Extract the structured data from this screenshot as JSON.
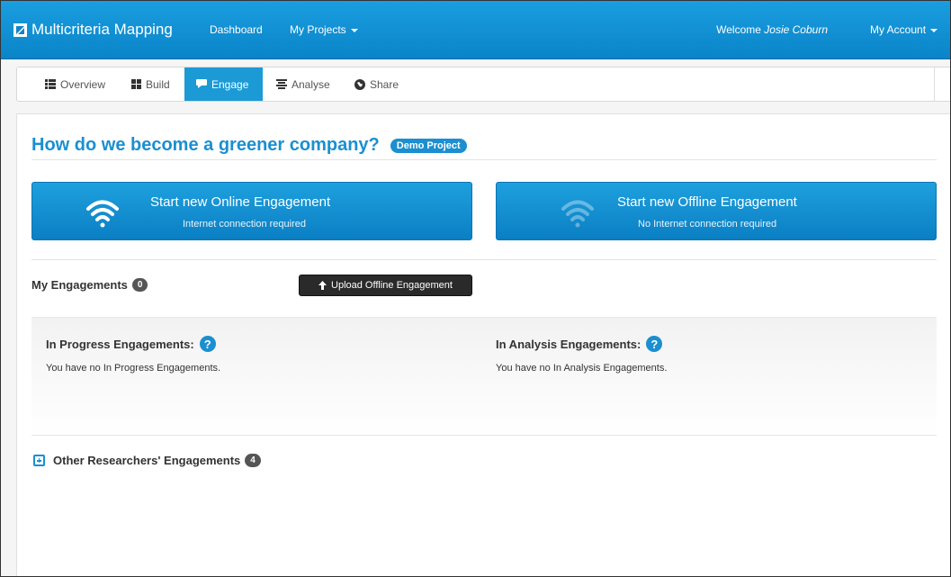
{
  "navbar": {
    "brand": "Multicriteria Mapping",
    "links": [
      "Dashboard",
      "My Projects"
    ],
    "welcome_prefix": "Welcome",
    "user_name": "Josie Coburn",
    "account": "My Account"
  },
  "tabs": [
    {
      "label": "Overview",
      "icon": "list-icon"
    },
    {
      "label": "Build",
      "icon": "grid-icon"
    },
    {
      "label": "Engage",
      "icon": "comment-icon",
      "active": true
    },
    {
      "label": "Analyse",
      "icon": "align-icon"
    },
    {
      "label": "Share",
      "icon": "globe-icon"
    }
  ],
  "project": {
    "title": "How do we become a greener company?",
    "badge": "Demo Project"
  },
  "online": {
    "label": "Start new Online Engagement",
    "sub": "Internet connection required"
  },
  "offline": {
    "label": "Start new Offline Engagement",
    "sub": "No Internet connection required"
  },
  "my_engagements": {
    "label": "My Engagements",
    "count": "0",
    "upload": "Upload Offline Engagement"
  },
  "in_progress": {
    "title": "In Progress Engagements:",
    "text": "You have no In Progress Engagements."
  },
  "in_analysis": {
    "title": "In Analysis Engagements:",
    "text": "You have no In Analysis Engagements."
  },
  "others": {
    "label": "Other Researchers' Engagements",
    "count": "4"
  },
  "colors": {
    "navbar": "#0e8fd1",
    "accent": "#1b8fd0",
    "active_tab": "#1b9ad6",
    "upload_button": "#2a2a2a"
  }
}
